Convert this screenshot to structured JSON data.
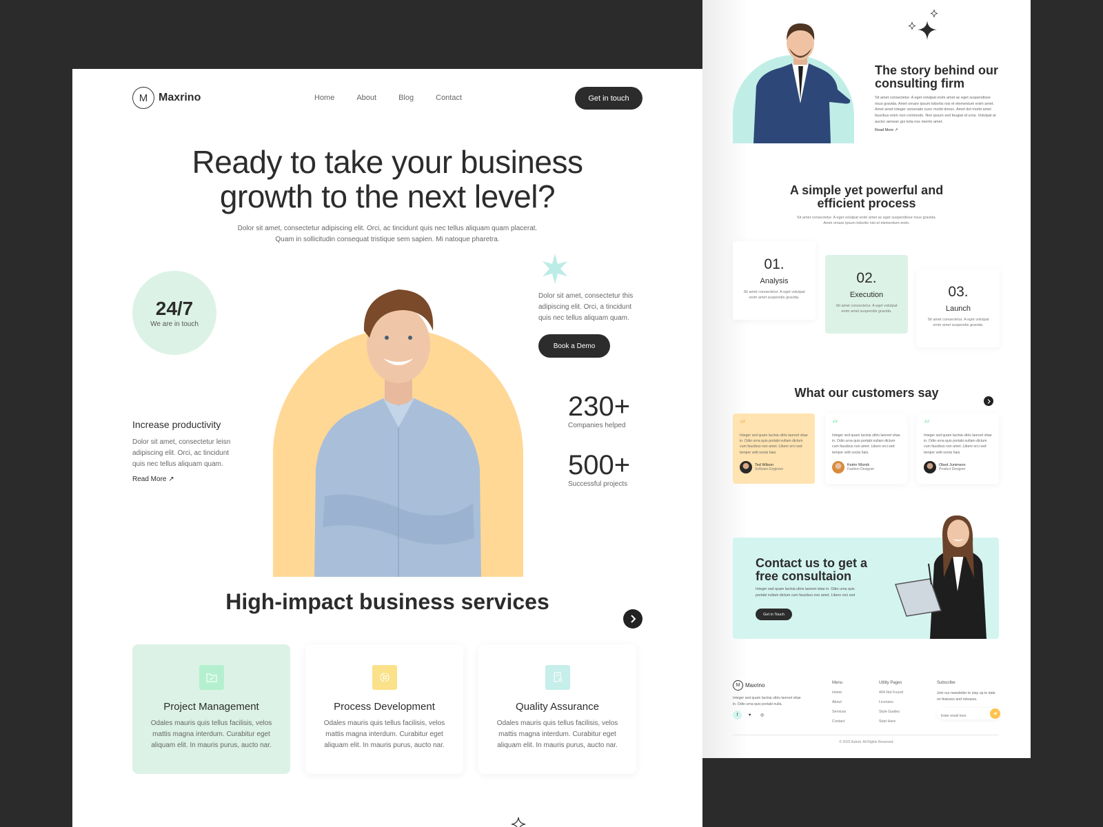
{
  "brand": {
    "name": "Maxrino",
    "logo_glyph": "M"
  },
  "nav": {
    "items": [
      "Home",
      "About",
      "Blog",
      "Contact"
    ],
    "cta": "Get in touch"
  },
  "hero": {
    "title_line1": "Ready to take your business",
    "title_line2": "growth to the next level?",
    "subtitle": "Dolor sit amet, consectetur adipiscing elit. Orci, ac tincidunt quis nec tellus aliquam quam placerat. Quam in sollicitudin consequat tristique sem sapien. Mi natoque pharetra.",
    "badge": {
      "value": "24/7",
      "label": "We are in touch"
    },
    "productivity": {
      "title": "Increase productivity",
      "text": "Dolor sit amet, consectetur leisn adipiscing elit. Orci, ac tincidunt quis nec tellus aliquam quam.",
      "link": "Read More ↗"
    },
    "side_text": "Dolor sit amet, consectetur this adipiscing elit. Orci, a tincidunt quis nec tellus aliquam quam.",
    "demo_button": "Book a Demo",
    "stats": [
      {
        "value": "230+",
        "label": "Companies helped"
      },
      {
        "value": "500+",
        "label": "Successful projects"
      }
    ]
  },
  "services": {
    "title": "High-impact business services",
    "items": [
      {
        "title": "Project Management",
        "text": "Odales mauris quis tellus facilisis, velos mattis magna interdum. Curabitur eget aliquam elit. In mauris purus, aucto nar.",
        "icon": "folder-check-icon",
        "icon_bg": "#b4f0cf"
      },
      {
        "title": "Process Development",
        "text": "Odales mauris quis tellus facilisis, velos mattis magna interdum. Curabitur eget aliquam elit. In mauris purus, aucto nar.",
        "icon": "process-cycle-icon",
        "icon_bg": "#fae18a"
      },
      {
        "title": "Quality Assurance",
        "text": "Odales mauris quis tellus facilisis, velos mattis magna interdum. Curabitur eget aliquam elit. In mauris purus, aucto nar.",
        "icon": "document-search-icon",
        "icon_bg": "#c6eeea"
      }
    ]
  },
  "story": {
    "title": "The story behind our consulting firm",
    "text": "Sit amet consectetur. A eget volutpat enim amet ac eget suspendisse risus gravida. Amet ornare ipsum lobortis nisi et elementum enim amet. Amet amet integer venenatis nunc morbi donec. Amet dol morbi amet faucibus enim non commodo. Non ipsum sed feugiat id urna. Volutpat at auctor aenean goi kola nos merrto amet.",
    "link": "Read More ↗"
  },
  "process": {
    "title": "A simple yet powerful and efficient process",
    "subtitle": "Sit amet consectetur. A eget volutpat enim amet ac eget suspendisse risus gravida. Amet ornare ipsum lobortis nisi et elementum enim.",
    "steps": [
      {
        "num": "01.",
        "title": "Analysis",
        "text": "Sit amet consectetur. A eget volutpat enim amet suspendis gravida."
      },
      {
        "num": "02.",
        "title": "Execution",
        "text": "Sit amet consectetur. A eget volutpat enim amet suspendis gravida."
      },
      {
        "num": "03.",
        "title": "Launch",
        "text": "Sit amet consectetur. A eget volutpat enim amet suspendis gravida."
      }
    ]
  },
  "testimonials": {
    "title": "What our customers say",
    "items": [
      {
        "text": "Integer sed quam lacinia ultris laoreet vitae in. Odio urna quis portabi nullam dictum cum faucibus non amet. Libero orci sed tempor velit sociis hais.",
        "name": "Ted Wilson",
        "role": "Software Engineer"
      },
      {
        "text": "Integer sed quam lacinia ultris laoreet vitae in. Odio urna quis portabi nullam dictum cum faucibus non amet. Libero orci sed tempor velit sociis hais.",
        "name": "Ketrin Wiznik",
        "role": "Fashion Designer"
      },
      {
        "text": "Integer sed quam lacinia ultris laoreet vitae in. Odio urna quis portabi nullam dictum cum faucibus non amet. Libero orci sed tempor velit sociis hais.",
        "name": "Obed Junimson",
        "role": "Product Designer"
      }
    ]
  },
  "contact": {
    "title": "Contact us to get a free consultaion",
    "text": "Integer sed quam lacinia ultris laoreet vitae in. Odio urna quis portabi nullam dictum cum faucibus non amet. Libero orci sed",
    "button": "Get in Touch"
  },
  "footer": {
    "about": "Integer sed quam lacinia ultris laoreet vitae in. Odio urna quis portabi nulla.",
    "socials": [
      "f",
      "♥",
      "◎"
    ],
    "menu": {
      "heading": "Menu",
      "links": [
        "Home",
        "About",
        "Services",
        "Contact"
      ]
    },
    "utility": {
      "heading": "Utility Pages",
      "links": [
        "404 Not Found",
        "Licenses",
        "Style Guides",
        "Start Here"
      ]
    },
    "subscribe": {
      "heading": "Subscribe",
      "text": "Join our newsletter to stay up to date on features and releases.",
      "placeholder": "Enter email here"
    },
    "copyright": "© 2022 Astroit. All Rights Reserved."
  },
  "colors": {
    "dark": "#2c2c2c",
    "mint": "#dcf2e6",
    "peach": "#ffd896",
    "teal": "#c0eee7",
    "accent_yellow": "#ffc24f"
  }
}
